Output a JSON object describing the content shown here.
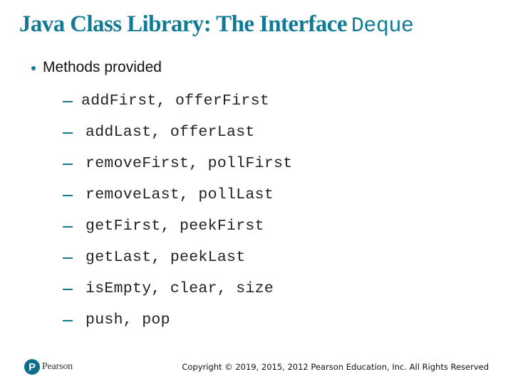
{
  "slide": {
    "title": {
      "text": "Java Class Library: The Interface",
      "code": "Deque",
      "color": "#127a95"
    },
    "bullet": {
      "text": "Methods provided",
      "icon": "bullet-dot-icon"
    },
    "methods": [
      {
        "text": "addFirst, offerFirst"
      },
      {
        "text": "addLast, offerLast"
      },
      {
        "text": "removeFirst, pollFirst"
      },
      {
        "text": "removeLast, pollLast"
      },
      {
        "text": "getFirst, peekFirst"
      },
      {
        "text": "getLast, peekLast"
      },
      {
        "text": "isEmpty, clear, size"
      },
      {
        "text": "push, pop"
      }
    ],
    "footer": {
      "logo_mark": "P",
      "logo_text": "Pearson",
      "copyright": "Copyright © 2019, 2015, 2012 Pearson Education, Inc. All Rights Reserved"
    }
  }
}
